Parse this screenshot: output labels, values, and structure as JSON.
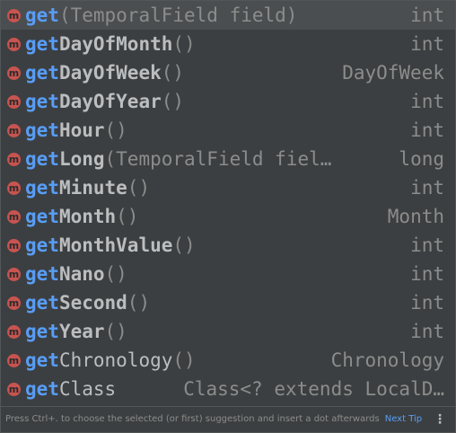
{
  "icon_glyph": "m",
  "colors": {
    "background": "#3c3f41",
    "selected_row": "#4b4e50",
    "prefix": "#589df6",
    "name": "#bbbdbf",
    "muted": "#8c8c8c",
    "method_icon": "#c75450"
  },
  "items": [
    {
      "prefix": "get",
      "name": "",
      "params": "(TemporalField field)",
      "type": "int"
    },
    {
      "prefix": "get",
      "name": "DayOfMonth",
      "params": "()",
      "type": "int"
    },
    {
      "prefix": "get",
      "name": "DayOfWeek",
      "params": "()",
      "type": "DayOfWeek"
    },
    {
      "prefix": "get",
      "name": "DayOfYear",
      "params": "()",
      "type": "int"
    },
    {
      "prefix": "get",
      "name": "Hour",
      "params": "()",
      "type": "int"
    },
    {
      "prefix": "get",
      "name": "Long",
      "params": "(TemporalField fiel…",
      "type": "long"
    },
    {
      "prefix": "get",
      "name": "Minute",
      "params": "()",
      "type": "int"
    },
    {
      "prefix": "get",
      "name": "Month",
      "params": "()",
      "type": "Month"
    },
    {
      "prefix": "get",
      "name": "MonthValue",
      "params": "()",
      "type": "int"
    },
    {
      "prefix": "get",
      "name": "Nano",
      "params": "()",
      "type": "int"
    },
    {
      "prefix": "get",
      "name": "Second",
      "params": "()",
      "type": "int"
    },
    {
      "prefix": "get",
      "name": "Year",
      "params": "()",
      "type": "int"
    },
    {
      "prefix": "get",
      "name": "Chronology",
      "params": "()",
      "type": "Chronology"
    },
    {
      "prefix": "get",
      "name": "Class",
      "params": "",
      "type": "Class<? extends LocalD…"
    }
  ],
  "footer": {
    "hint": "Press Ctrl+. to choose the selected (or first) suggestion and insert a dot afterwards",
    "next_tip": "Next Tip",
    "more_icon": "⋮"
  }
}
